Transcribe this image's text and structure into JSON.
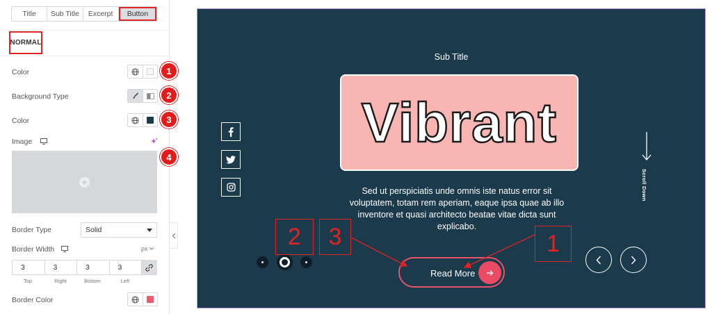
{
  "panel": {
    "tabs": [
      {
        "label": "Title"
      },
      {
        "label": "Sub Title"
      },
      {
        "label": "Excerpt"
      },
      {
        "label": "Button"
      }
    ],
    "section_label": "NORMAL",
    "fields": {
      "color_label": "Color",
      "background_type_label": "Background Type",
      "bg_color_label": "Color",
      "image_label": "Image",
      "border_type_label": "Border Type",
      "border_type_value": "Solid",
      "border_width_label": "Border Width",
      "unit": "px",
      "border_width": {
        "values": [
          "3",
          "3",
          "3",
          "3"
        ],
        "labels": [
          "Top",
          "Right",
          "Bottom",
          "Left"
        ]
      },
      "border_color_label": "Border Color"
    },
    "badges": [
      "1",
      "2",
      "3",
      "4"
    ],
    "colors": {
      "text_color_swatch": "#ffffff",
      "bg_color_swatch": "#1b3a4b",
      "border_color_swatch": "#ee5a6f"
    }
  },
  "preview": {
    "subtitle": "Sub Title",
    "title": "Vibrant",
    "excerpt": "Sed ut perspiciatis unde omnis iste natus error sit voluptatem, totam rem aperiam, eaque ipsa quae ab illo inventore et quasi architecto beatae vitae dicta sunt explicabo.",
    "button_label": "Read More",
    "scroll_label": "Scroll Down",
    "colors": {
      "background": "#1b3a4b",
      "title_box": "#f9b5b1",
      "accent": "#ea4b64"
    }
  },
  "callouts": [
    "2",
    "3",
    "1"
  ]
}
